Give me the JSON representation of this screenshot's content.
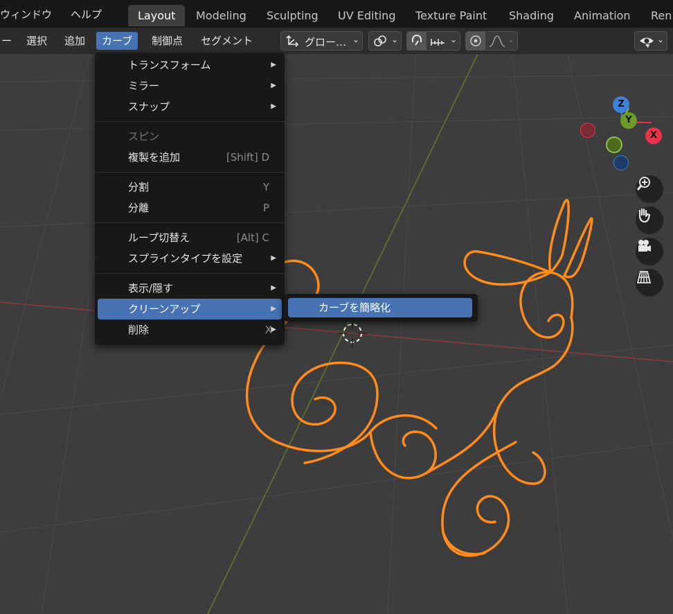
{
  "topbar": {
    "menus": [
      "ウィンドウ",
      "ヘルプ"
    ],
    "workspace_tabs": [
      "Layout",
      "Modeling",
      "Sculpting",
      "UV Editing",
      "Texture Paint",
      "Shading",
      "Animation",
      "Ren"
    ],
    "active_tab": "Layout"
  },
  "header": {
    "items": [
      "ー",
      "選択",
      "追加",
      "カーブ",
      "制御点",
      "セグメント"
    ],
    "active_item": "カーブ",
    "transform_orientation": "グロー…"
  },
  "menu": {
    "items": [
      {
        "label": "トランスフォーム",
        "shortcut": "",
        "submenu": true
      },
      {
        "label": "ミラー",
        "shortcut": "",
        "submenu": true
      },
      {
        "label": "スナップ",
        "shortcut": "",
        "submenu": true
      },
      {
        "label": "スピン",
        "shortcut": "",
        "submenu": false,
        "disabled": true
      },
      {
        "label": "複製を追加",
        "shortcut": "[Shift] D",
        "submenu": false
      },
      {
        "label": "分割",
        "shortcut": "Y",
        "submenu": false
      },
      {
        "label": "分離",
        "shortcut": "P",
        "submenu": false
      },
      {
        "label": "ループ切替え",
        "shortcut": "[Alt] C",
        "submenu": false
      },
      {
        "label": "スプラインタイプを設定",
        "shortcut": "",
        "submenu": true
      },
      {
        "label": "表示/隠す",
        "shortcut": "",
        "submenu": true
      },
      {
        "label": "クリーンアップ",
        "shortcut": "",
        "submenu": true,
        "highlighted": true
      },
      {
        "label": "削除",
        "shortcut": "X",
        "submenu": true
      }
    ]
  },
  "submenu": {
    "items": [
      {
        "label": "カーブを簡略化"
      }
    ]
  },
  "gizmo": {
    "z": "Z",
    "y": "Y",
    "x": "X"
  },
  "colors": {
    "accent": "#4772b3",
    "curve": "#ff8c1a",
    "x_axis": "#e8334a",
    "y_axis": "#8bc34a",
    "z_axis": "#3b82d6"
  }
}
